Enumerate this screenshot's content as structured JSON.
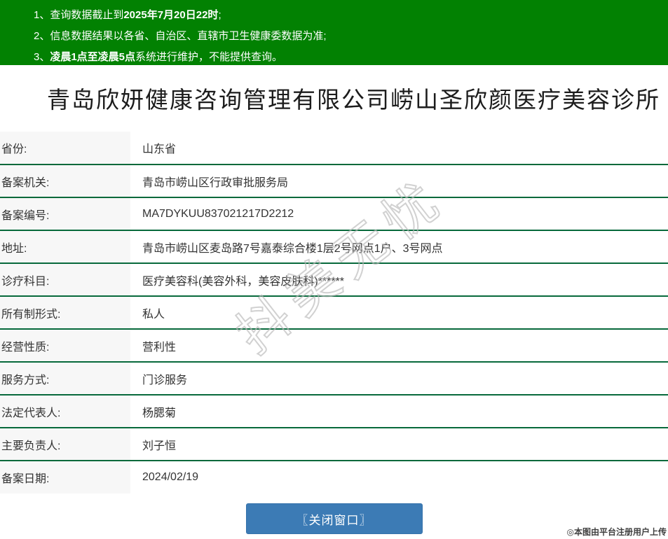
{
  "banner": {
    "background": "#028102",
    "notices": [
      {
        "prefix": "1、查询数据截止到",
        "bold": "2025年7月20日22时",
        "suffix": ";"
      },
      {
        "prefix": "2、信息数据结果以各省、自治区、直辖市卫生健康委数据为准;",
        "bold": "",
        "suffix": ""
      },
      {
        "prefix": "3、",
        "bold": "凌晨1点至凌晨5点",
        "suffix": "系统进行维护，不能提供查询。"
      }
    ]
  },
  "page": {
    "title": "青岛欣妍健康咨询管理有限公司崂山圣欣颜医疗美容诊所"
  },
  "records": {
    "rows": [
      {
        "label": "省份:",
        "value": "山东省"
      },
      {
        "label": "备案机关:",
        "value": "青岛市崂山区行政审批服务局"
      },
      {
        "label": "备案编号:",
        "value": "MA7DYKUU837021217D2212"
      },
      {
        "label": "地址:",
        "value": "青岛市崂山区麦岛路7号嘉泰综合楼1层2号网点1户、3号网点"
      },
      {
        "label": "诊疗科目:",
        "value": "医疗美容科(美容外科，美容皮肤科)******"
      },
      {
        "label": "所有制形式:",
        "value": "私人"
      },
      {
        "label": "经营性质:",
        "value": "营利性"
      },
      {
        "label": "服务方式:",
        "value": "门诊服务"
      },
      {
        "label": "法定代表人:",
        "value": "杨腮菊"
      },
      {
        "label": "主要负责人:",
        "value": "刘子恒"
      },
      {
        "label": "备案日期:",
        "value": "2024/02/19"
      }
    ]
  },
  "watermark": {
    "text": "抖美无忧"
  },
  "footer": {
    "close_button_label": "〖关闭窗口〗",
    "attribution": "◎本图由平台注册用户上传"
  },
  "colors": {
    "banner_green": "#028102",
    "divider_green": "#07693b",
    "button_blue": "#3c7bb5",
    "label_bg": "#f7f7f7"
  }
}
